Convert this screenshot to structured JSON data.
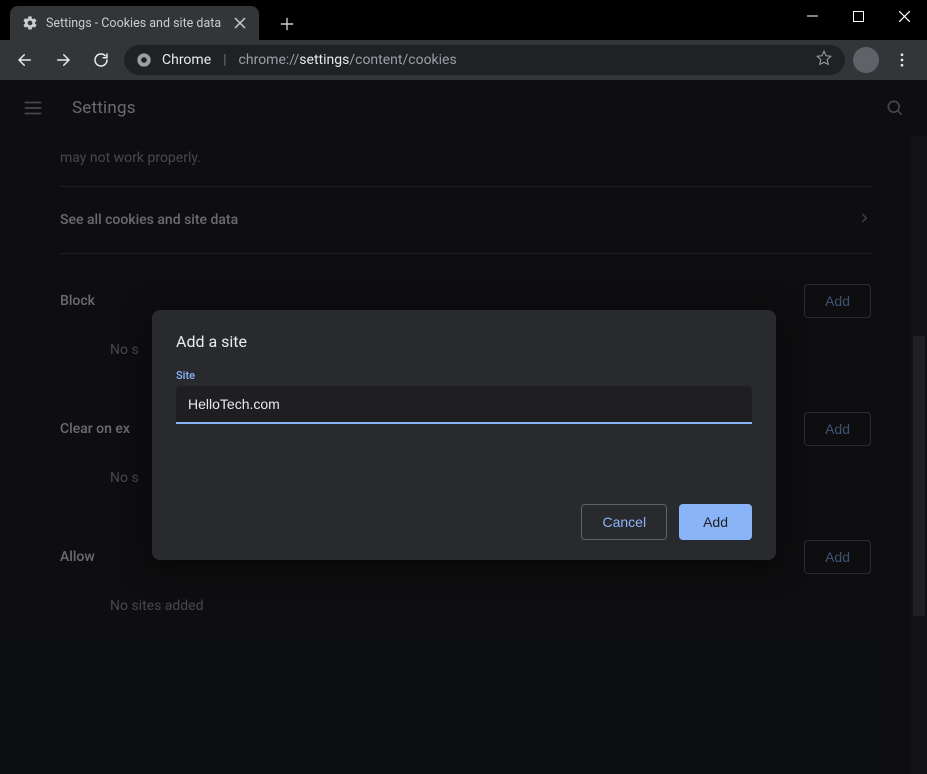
{
  "tab": {
    "title": "Settings - Cookies and site data"
  },
  "omnibox": {
    "origin_label": "Chrome",
    "url_dim1": "chrome://",
    "url_bright1": "settings",
    "url_dim2": "/content/cookies"
  },
  "header": {
    "title": "Settings"
  },
  "page": {
    "truncated_desc": "may not work properly.",
    "see_all": "See all cookies and site data",
    "block": {
      "title": "Block",
      "add": "Add",
      "empty_partial": "No s"
    },
    "clear": {
      "title_partial": "Clear on ex",
      "add": "Add",
      "empty_partial": "No s"
    },
    "allow": {
      "title": "Allow",
      "add": "Add",
      "empty": "No sites added"
    }
  },
  "dialog": {
    "title": "Add a site",
    "field_label": "Site",
    "value": "HelloTech.com",
    "cancel": "Cancel",
    "confirm": "Add"
  }
}
